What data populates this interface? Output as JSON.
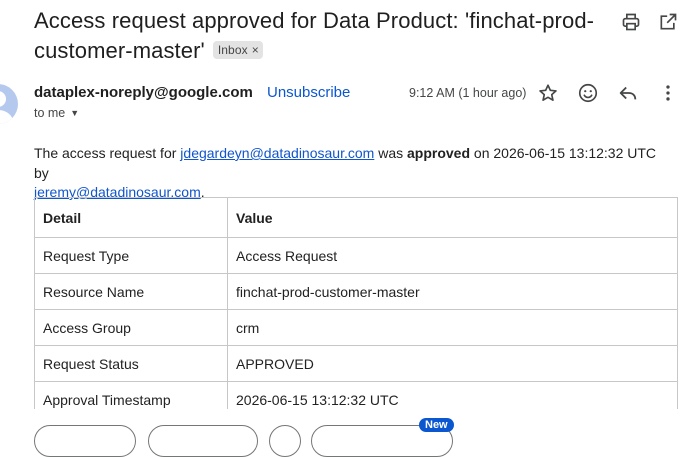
{
  "email": {
    "subject": "Access request approved for Data Product: 'finchat-prod-customer-master'",
    "label": "Inbox",
    "sender": "dataplex-noreply@google.com",
    "unsubscribe": "Unsubscribe",
    "time": "9:12 AM (1 hour ago)",
    "recipient": "to me",
    "body": {
      "intro": "The access request for ",
      "requester": "jdegardeyn@datadinosaur.com",
      "mid": " was ",
      "status_word": "approved",
      "after": " on 2026-06-15 13:12:32 UTC by",
      "approver": "jeremy@datadinosaur.com",
      "end": "."
    },
    "table": {
      "headers": [
        "Detail",
        "Value"
      ],
      "rows": [
        [
          "Request Type",
          "Access Request"
        ],
        [
          "Resource Name",
          "finchat-prod-customer-master"
        ],
        [
          "Access Group",
          "crm"
        ],
        [
          "Request Status",
          "APPROVED"
        ],
        [
          "Approval Timestamp",
          "2026-06-15 13:12:32 UTC"
        ]
      ]
    },
    "reply_bar": {
      "new_badge": "New"
    }
  },
  "icons": {
    "print": "print-icon",
    "open_new": "open-in-new-window-icon",
    "star": "star-icon",
    "emoji": "emoji-reaction-icon",
    "reply": "reply-icon",
    "more": "more-vert-icon",
    "avatar": "avatar-person-icon"
  },
  "colors": {
    "link": "#0b57d0",
    "body_link": "#1155cc",
    "badge_bg": "#e3e3e3",
    "avatar_bg": "#b5c9ee",
    "new_badge_bg": "#0b57d0"
  }
}
